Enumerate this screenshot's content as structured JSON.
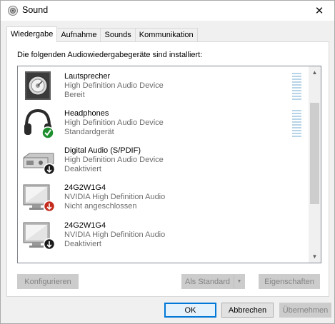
{
  "window": {
    "title": "Sound",
    "close_glyph": "✕"
  },
  "tabs": [
    {
      "label": "Wiedergabe",
      "active": true
    },
    {
      "label": "Aufnahme",
      "active": false
    },
    {
      "label": "Sounds",
      "active": false
    },
    {
      "label": "Kommunikation",
      "active": false
    }
  ],
  "panel": {
    "heading": "Die folgenden Audiowiedergabegeräte sind installiert:"
  },
  "devices": [
    {
      "name": "Lautsprecher",
      "driver": "High Definition Audio Device",
      "status": "Bereit",
      "icon": "speaker-icon",
      "badge": "none",
      "level_meter": true
    },
    {
      "name": "Headphones",
      "driver": "High Definition Audio Device",
      "status": "Standardgerät",
      "icon": "headphones-icon",
      "badge": "default-check",
      "level_meter": true
    },
    {
      "name": "Digital Audio (S/PDIF)",
      "driver": "High Definition Audio Device",
      "status": "Deaktiviert",
      "icon": "digital-audio-icon",
      "badge": "disabled-arrow",
      "level_meter": false
    },
    {
      "name": "24G2W1G4",
      "driver": "NVIDIA High Definition Audio",
      "status": "Nicht angeschlossen",
      "icon": "monitor-icon",
      "badge": "unplugged-arrow",
      "level_meter": false
    },
    {
      "name": "24G2W1G4",
      "driver": "NVIDIA High Definition Audio",
      "status": "Deaktiviert",
      "icon": "monitor-icon",
      "badge": "disabled-arrow",
      "level_meter": false
    }
  ],
  "buttons": {
    "configure": "Konfigurieren",
    "set_default": "Als Standard",
    "properties": "Eigenschaften",
    "ok": "OK",
    "cancel": "Abbrechen",
    "apply": "Übernehmen"
  },
  "colors": {
    "accent": "#0078d7",
    "default_badge": "#1e8f2e",
    "unplugged_badge": "#c42b1c",
    "disabled_badge": "#1a1a1a",
    "level_meter": "#b8d4e8"
  }
}
